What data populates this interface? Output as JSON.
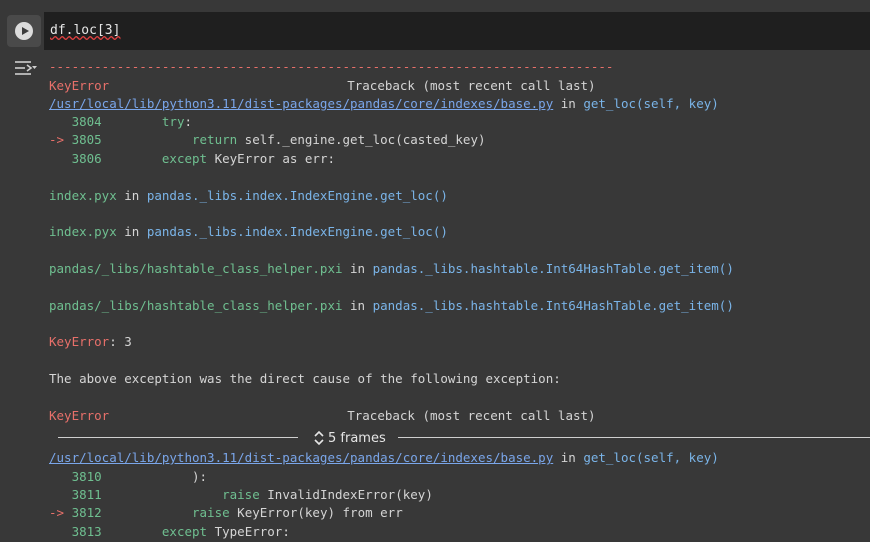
{
  "cell": {
    "code": "df.loc[3]"
  },
  "output": {
    "dash_line": "---------------------------------------------------------------------------",
    "traceback1": {
      "error_name": "KeyError",
      "traceback_label": "Traceback (most recent call last)",
      "file_path": "/usr/local/lib/python3.11/dist-packages/pandas/core/indexes/base.py",
      "in_text": " in ",
      "func_sig": "get_loc(self, key)",
      "lines": [
        {
          "marker": "   ",
          "num": "3804",
          "indent": "        ",
          "kw": "try",
          "rest": ":"
        },
        {
          "marker": "-> ",
          "num": "3805",
          "indent": "            ",
          "kw": "return",
          "rest": " self._engine.get_loc(casted_key)"
        },
        {
          "marker": "   ",
          "num": "3806",
          "indent": "        ",
          "kw": "except",
          "rest": " KeyError as err:"
        }
      ],
      "frames": [
        {
          "file": "index.pyx",
          "in": " in ",
          "func": "pandas._libs.index.IndexEngine.get_loc()"
        },
        {
          "file": "index.pyx",
          "in": " in ",
          "func": "pandas._libs.index.IndexEngine.get_loc()"
        },
        {
          "file": "pandas/_libs/hashtable_class_helper.pxi",
          "in": " in ",
          "func": "pandas._libs.hashtable.Int64HashTable.get_item()"
        },
        {
          "file": "pandas/_libs/hashtable_class_helper.pxi",
          "in": " in ",
          "func": "pandas._libs.hashtable.Int64HashTable.get_item()"
        }
      ],
      "final_error": "KeyError",
      "final_value": ": 3"
    },
    "cause_message": "The above exception was the direct cause of the following exception:",
    "traceback2": {
      "error_name": "KeyError",
      "traceback_label": "Traceback (most recent call last)",
      "frames_collapsed": "5 frames",
      "file_path": "/usr/local/lib/python3.11/dist-packages/pandas/core/indexes/base.py",
      "in_text": " in ",
      "func_sig": "get_loc(self, key)",
      "lines": [
        {
          "marker": "   ",
          "num": "3810",
          "indent": "            ",
          "kw": "",
          "rest": "):"
        },
        {
          "marker": "   ",
          "num": "3811",
          "indent": "                ",
          "kw": "raise",
          "rest": " InvalidIndexError(key)"
        },
        {
          "marker": "-> ",
          "num": "3812",
          "indent": "            ",
          "kw": "raise",
          "rest": " KeyError(key) from err"
        },
        {
          "marker": "   ",
          "num": "3813",
          "indent": "        ",
          "kw": "except",
          "rest": " TypeError:"
        }
      ]
    }
  }
}
